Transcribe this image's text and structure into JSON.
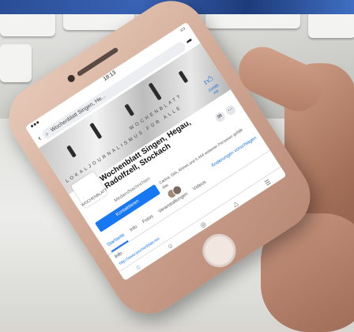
{
  "status_bar": {
    "time": "18:13"
  },
  "search": {
    "query": "Wochenblatt Singen, He..."
  },
  "cover": {
    "text_line1": "LOKALJOURNALISMUS FÜR ALLE",
    "text_line2": "WOCHENBLATT",
    "like_label": "Gefällt mir"
  },
  "profile": {
    "avatar_label": "WOCHENBLATT",
    "name": "Wochenblatt Singen, Hegau, Radolfzell, Stockach",
    "category": "Medien/Nachrichten"
  },
  "actions": {
    "contact_label": "Kontaktieren",
    "friends_text": "Carina, Dirk, Ahmet und 5.454 weiteren Personen gefällt das",
    "suggest_label": "Änderungen vorschlagen"
  },
  "tabs": [
    "Startseite",
    "Info",
    "Fotos",
    "Veranstaltungen",
    "Videos"
  ],
  "info": {
    "heading": "Info",
    "url": "http://www.wochenblatt.net"
  },
  "colors": {
    "accent": "#1877f2"
  }
}
